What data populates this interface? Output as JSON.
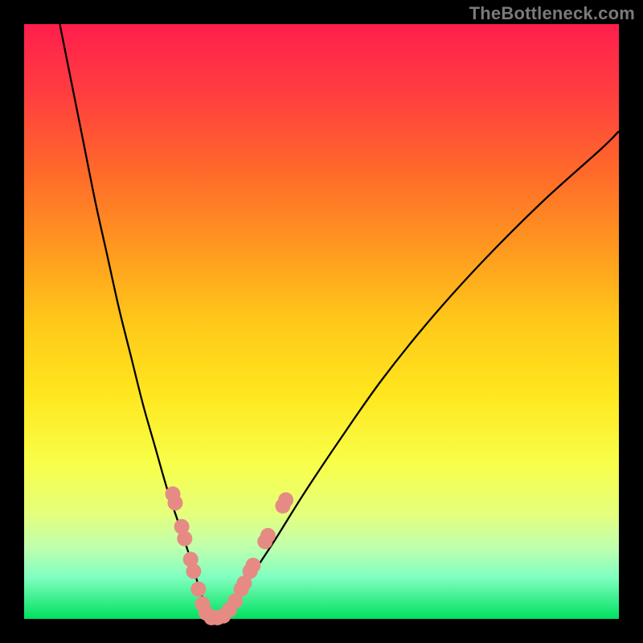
{
  "watermark": "TheBottleneck.com",
  "colors": {
    "curve": "#000000",
    "marker_fill": "#e58b84",
    "marker_stroke": "#cf6f68"
  },
  "chart_data": {
    "type": "line",
    "title": "",
    "xlabel": "",
    "ylabel": "",
    "xlim": [
      0,
      100
    ],
    "ylim": [
      0,
      100
    ],
    "series": [
      {
        "name": "left-branch",
        "x": [
          6,
          8,
          10,
          12,
          14,
          16,
          18,
          20,
          22,
          24,
          26,
          28,
          29.5,
          30.5,
          31,
          31.5
        ],
        "y": [
          100,
          90,
          80,
          70,
          61,
          52,
          44,
          36,
          29,
          22,
          16,
          10,
          5,
          2,
          0.7,
          0
        ]
      },
      {
        "name": "right-branch",
        "x": [
          31.5,
          33,
          35,
          38,
          42,
          47,
          53,
          60,
          68,
          77,
          87,
          97,
          100
        ],
        "y": [
          0,
          1,
          3,
          7,
          13,
          21,
          30,
          40,
          50,
          60,
          70,
          79,
          82
        ]
      }
    ],
    "markers": [
      {
        "x": 25.0,
        "y": 21.0
      },
      {
        "x": 25.4,
        "y": 19.5
      },
      {
        "x": 26.5,
        "y": 15.5
      },
      {
        "x": 27.0,
        "y": 13.5
      },
      {
        "x": 28.0,
        "y": 10.0
      },
      {
        "x": 28.5,
        "y": 8.0
      },
      {
        "x": 29.3,
        "y": 5.0
      },
      {
        "x": 30.0,
        "y": 2.5
      },
      {
        "x": 30.6,
        "y": 1.0
      },
      {
        "x": 31.5,
        "y": 0.2
      },
      {
        "x": 32.5,
        "y": 0.2
      },
      {
        "x": 33.5,
        "y": 0.5
      },
      {
        "x": 34.5,
        "y": 1.5
      },
      {
        "x": 35.5,
        "y": 3.0
      },
      {
        "x": 36.5,
        "y": 5.0
      },
      {
        "x": 37.0,
        "y": 6.0
      },
      {
        "x": 38.0,
        "y": 8.0
      },
      {
        "x": 38.5,
        "y": 9.0
      },
      {
        "x": 40.5,
        "y": 13.0
      },
      {
        "x": 41.0,
        "y": 14.0
      },
      {
        "x": 43.5,
        "y": 19.0
      },
      {
        "x": 44.0,
        "y": 20.0
      }
    ]
  }
}
